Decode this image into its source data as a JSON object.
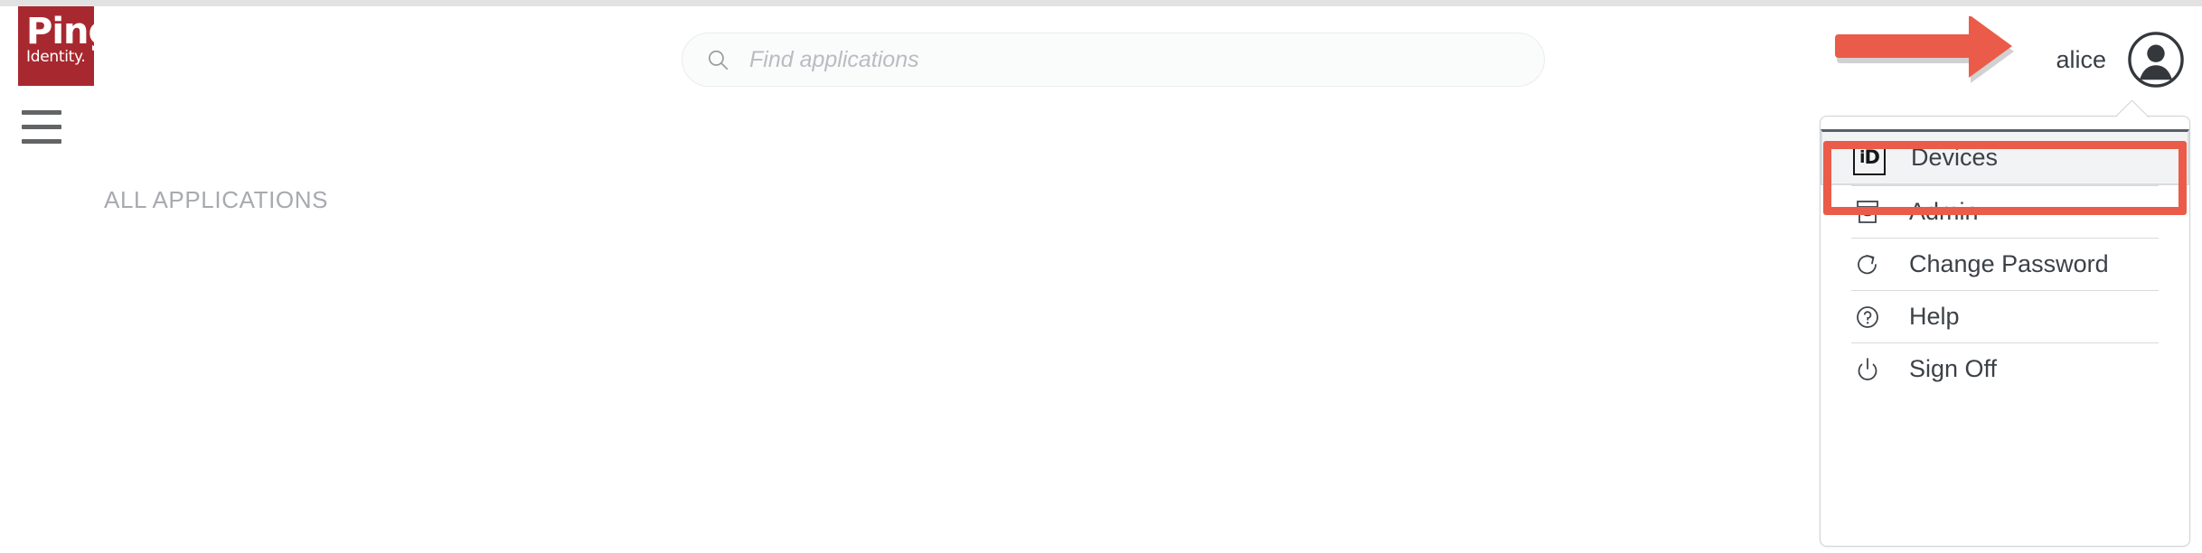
{
  "brand": {
    "logo_line1": "Ping",
    "logo_line2": "Identity.",
    "logo_color": "#a8282f"
  },
  "header": {
    "menu_icon": "hamburger-icon",
    "search": {
      "icon": "search-icon",
      "placeholder": "Find applications",
      "value": ""
    },
    "user": {
      "name": "alice",
      "avatar_icon": "user-avatar-icon"
    }
  },
  "main": {
    "section_title": "ALL APPLICATIONS"
  },
  "user_menu": {
    "items": [
      {
        "label": "Devices",
        "icon": "id-badge-icon",
        "highlighted": true
      },
      {
        "label": "Admin",
        "icon": "archive-box-icon",
        "highlighted": false
      },
      {
        "label": "Change Password",
        "icon": "refresh-arrow-icon",
        "highlighted": false
      },
      {
        "label": "Help",
        "icon": "question-circle-icon",
        "highlighted": false
      },
      {
        "label": "Sign Off",
        "icon": "power-icon",
        "highlighted": false
      }
    ]
  },
  "annotations": {
    "arrow_color": "#ea5c49",
    "box_color": "#ea5c49",
    "arrow_target": "alice",
    "box_target": "Devices"
  }
}
